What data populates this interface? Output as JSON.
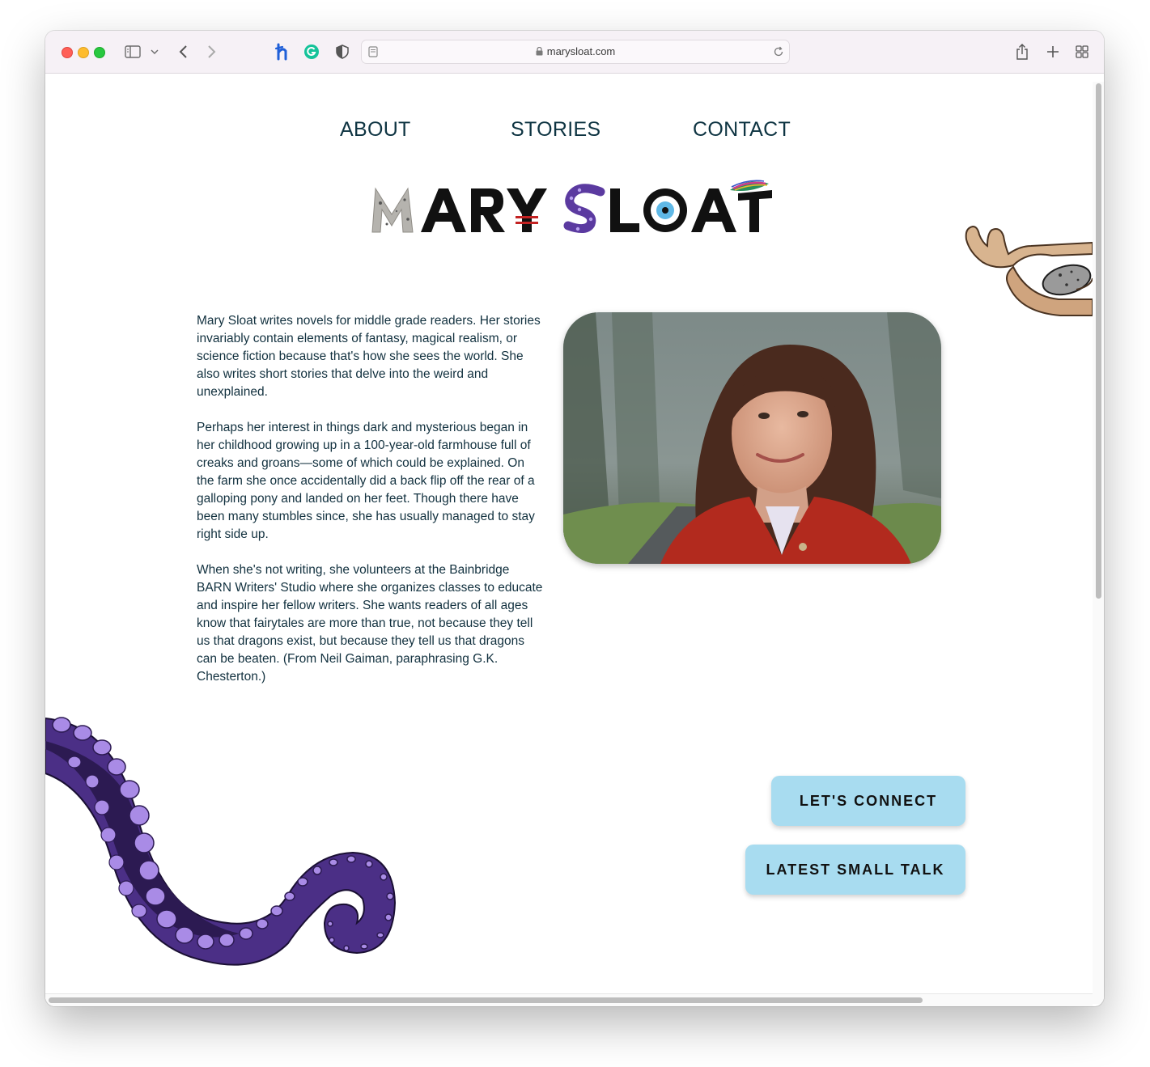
{
  "browser": {
    "url": "marysloat.com"
  },
  "nav": {
    "about": "ABOUT",
    "stories": "STORIES",
    "contact": "CONTACT"
  },
  "logo": {
    "text": "MARY SLOAT"
  },
  "bio": {
    "paragraphs": [
      "Mary Sloat writes novels for middle grade readers. Her stories invariably contain elements of fantasy, magical realism, or science fiction because that's how she sees the world. She also writes short stories that delve into the weird and unexplained.",
      "Perhaps her interest in things dark and mysterious began in her childhood growing up in a 100-year-old farmhouse full of creaks and groans—some of which could be explained. On the farm she once accidentally did a back flip off the rear of a galloping pony and landed on her feet. Though there have been many stumbles since, she has usually managed to stay right side up.",
      "When she's not writing, she volunteers at the Bainbridge BARN Writers' Studio where she organizes classes to educate and inspire her fellow writers. She wants readers of all ages know that fairytales are more than true, not because they tell us that dragons exist, but because they tell us that dragons can be beaten. (From Neil Gaiman, paraphrasing G.K. Chesterton.)"
    ]
  },
  "buttons": {
    "connect": "LET'S CONNECT",
    "small_talk": "LATEST SMALL TALK"
  },
  "colors": {
    "nav_text": "#0e3442",
    "button_bg": "#a8dcf0",
    "tentacle": "#4f2f86",
    "suction_cup": "#a98be6"
  }
}
